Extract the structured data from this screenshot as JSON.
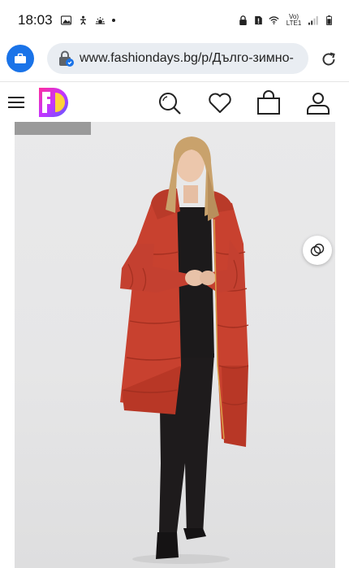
{
  "status_bar": {
    "time": "18:03",
    "network": "Vo) LTE1"
  },
  "browser": {
    "url": "www.fashiondays.bg/p/Дълго-зимно-"
  },
  "site": {
    "brand": "fashiondays",
    "icons": [
      "menu-icon",
      "search-icon",
      "heart-icon",
      "bag-icon",
      "account-icon"
    ]
  },
  "product": {
    "image_alt": "model wearing long red quilted puffer coat",
    "coat_color": "#c8412f"
  }
}
